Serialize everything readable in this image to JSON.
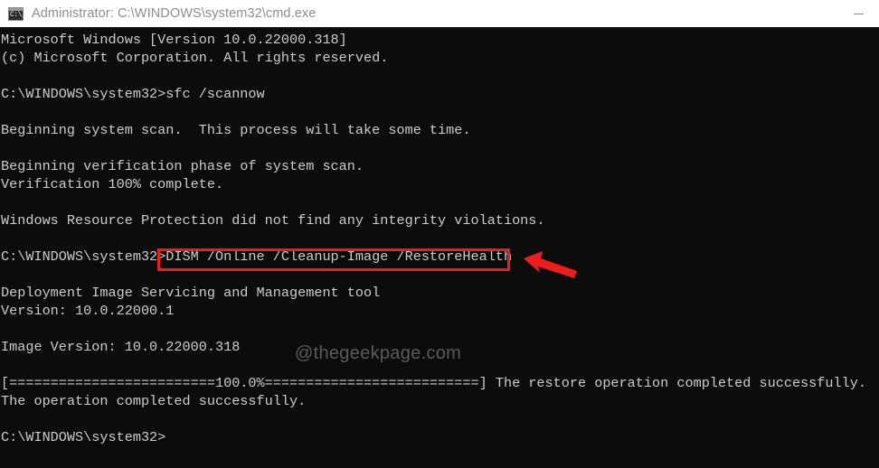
{
  "window": {
    "title": "Administrator: C:\\WINDOWS\\system32\\cmd.exe",
    "icon": "cmd-console-icon",
    "icon_glyph": "C:\\_",
    "controls": {
      "minimize_label": "—"
    },
    "titlebar_bg": "#ffffff",
    "title_color": "#8d8d8d"
  },
  "console": {
    "background": "#0c0c0c",
    "foreground": "#cccccc",
    "prompt": "C:\\WINDOWS\\system32>",
    "lines": [
      "Microsoft Windows [Version 10.0.22000.318]",
      "(c) Microsoft Corporation. All rights reserved.",
      "",
      "C:\\WINDOWS\\system32>sfc /scannow",
      "",
      "Beginning system scan.  This process will take some time.",
      "",
      "Beginning verification phase of system scan.",
      "Verification 100% complete.",
      "",
      "Windows Resource Protection did not find any integrity violations.",
      "",
      "C:\\WINDOWS\\system32>DISM /Online /Cleanup-Image /RestoreHealth",
      "",
      "Deployment Image Servicing and Management tool",
      "Version: 10.0.22000.1",
      "",
      "Image Version: 10.0.22000.318",
      "",
      "[=========================100.0%==========================] The restore operation completed successfully.",
      "The operation completed successfully.",
      "",
      "C:\\WINDOWS\\system32>"
    ]
  },
  "annotations": {
    "highlight_color": "#ee1c1c",
    "highlighted_command": "DISM /Online /Cleanup-Image /RestoreHealth",
    "arrow": "left-pointing-arrow"
  },
  "watermark": {
    "text": "@thegeekpage.com",
    "color": "#5a5a5a"
  }
}
